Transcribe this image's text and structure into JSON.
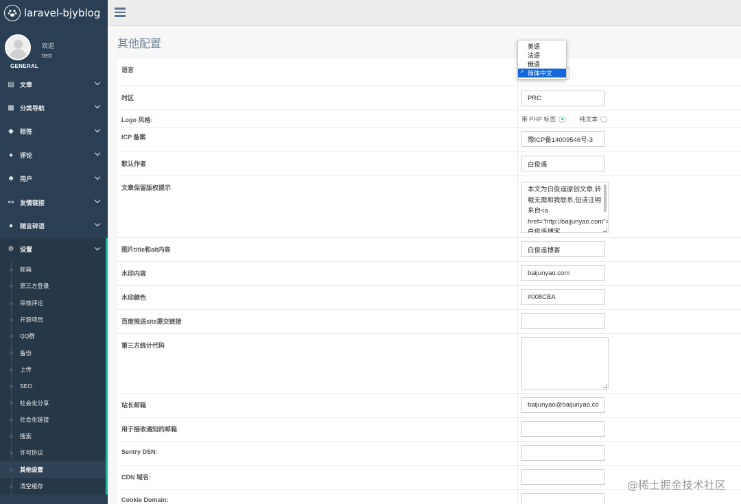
{
  "brand": {
    "title": "laravel-bjyblog",
    "logo_icon": "paw-icon"
  },
  "profile": {
    "welcome": "欢迎",
    "name": "test",
    "section": "GENERAL"
  },
  "menu": [
    {
      "label": "文章",
      "icon": "book-icon",
      "glyph": "▤"
    },
    {
      "label": "分类导航",
      "icon": "grid-icon",
      "glyph": "▦"
    },
    {
      "label": "标签",
      "icon": "tag-icon",
      "glyph": "◆"
    },
    {
      "label": "评论",
      "icon": "comment-icon",
      "glyph": "●"
    },
    {
      "label": "用户",
      "icon": "users-icon",
      "glyph": "☻"
    },
    {
      "label": "友情链接",
      "icon": "link-icon",
      "glyph": "⚯"
    },
    {
      "label": "随言碎语",
      "icon": "chat-icon",
      "glyph": "●"
    },
    {
      "label": "设置",
      "icon": "gears-icon",
      "glyph": "⚙"
    }
  ],
  "submenu": [
    "邮箱",
    "第三方登录",
    "审核评论",
    "开源项目",
    "QQ群",
    "备份",
    "上传",
    "SEO",
    "社会化分享",
    "社会化链接",
    "搜索",
    "许可协议",
    "其他设置",
    "清空缓存"
  ],
  "page": {
    "title": "其他配置"
  },
  "language": {
    "label": "语言",
    "options": [
      "英语",
      "法语",
      "俄语",
      "简体中文"
    ],
    "selected": "简体中文"
  },
  "fields": {
    "timezone": {
      "label": "时区",
      "value": "PRC"
    },
    "logo_style": {
      "label": "Logo 风格:",
      "option1": "带 PHP 标签",
      "option2": "纯文本"
    },
    "icp": {
      "label": "ICP 备案",
      "value": "豫ICP备14009546号-3"
    },
    "author": {
      "label": "默认作者",
      "value": "白俊遥"
    },
    "copyright": {
      "label": "文章保留版权提示",
      "value": "本文为白俊遥原创文章,转载无需和我联系,但请注明来自<a href=\"http://baijunyao.com\">白俊遥博客"
    },
    "img_alt": {
      "label": "图片title和alt内容",
      "value": "白俊遥博客"
    },
    "watermark_text": {
      "label": "水印内容",
      "value": "baijunyao.com"
    },
    "watermark_color": {
      "label": "水印颜色",
      "value": "#008CBA"
    },
    "baidu_push": {
      "label": "百度推送site提交链接",
      "value": ""
    },
    "stats_code": {
      "label": "第三方统计代码",
      "value": ""
    },
    "admin_email": {
      "label": "站长邮箱",
      "value": "baijunyao@baijunyao.co"
    },
    "notify_email": {
      "label": "用于接收通知的邮箱",
      "value": ""
    },
    "sentry": {
      "label": "Sentry DSN:",
      "value": ""
    },
    "cdn": {
      "label": "CDN 域名:",
      "value": ""
    },
    "cookie": {
      "label": "Cookie Domain:",
      "value": ""
    }
  },
  "watermark": "@稀土掘金技术社区",
  "colors": {
    "sidebar": "#2a3f54",
    "accent": "#1abb9c",
    "select": "#1467d8"
  }
}
